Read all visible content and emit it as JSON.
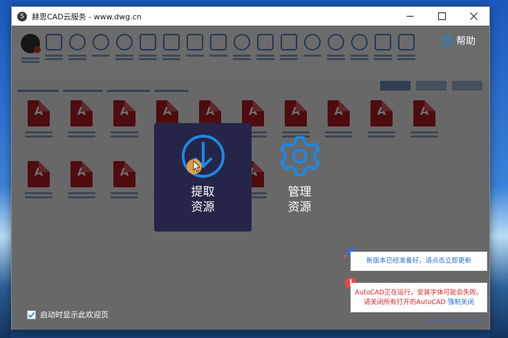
{
  "window": {
    "title": "赫思CAD云服务 - www.dwg.cn",
    "app_icon_glyph": "S",
    "controls": [
      "minimize-icon",
      "maximize-icon",
      "close-icon"
    ]
  },
  "header": {
    "help_label": "帮助",
    "help_icon": "question-circle-icon"
  },
  "actions": {
    "extract": {
      "label_line1": "提取",
      "label_line2": "资源",
      "icon": "download-circle-icon"
    },
    "manage": {
      "label_line1": "管理",
      "label_line2": "资源",
      "icon": "gear-icon"
    }
  },
  "notifications": {
    "update": {
      "text": "新版本已经准备好，请点击立即更新",
      "icon": "rocket-icon"
    },
    "warning": {
      "line1": "AutoCAD正在运行，安装字体可能会失败。",
      "line2_prefix": "请关闭所有打开的AutoCAD ",
      "force_close_link": "强制关闭",
      "icon": "exclamation-circle-icon"
    }
  },
  "footer": {
    "show_on_startup_label": "启动时显示此欢迎页",
    "show_on_startup_checked": true
  },
  "colors": {
    "accent_blue": "#1e88e5",
    "card_bg": "#25254a",
    "warning_red": "#e0272c",
    "link_blue": "#2a6fd0"
  }
}
